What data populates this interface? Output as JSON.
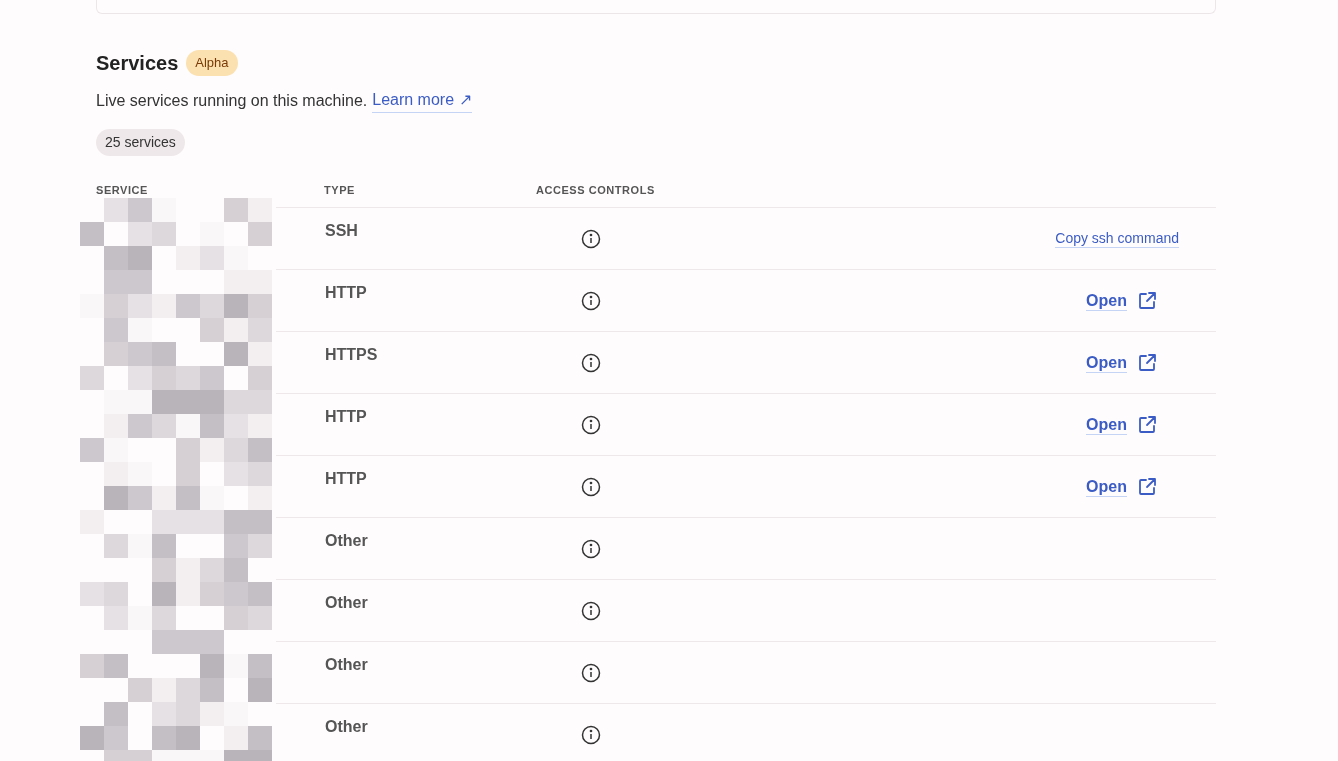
{
  "section": {
    "title": "Services",
    "badge": "Alpha",
    "description": "Live services running on this machine.",
    "learn_more": "Learn more ↗",
    "count": "25 services"
  },
  "table": {
    "columns": [
      "SERVICE",
      "TYPE",
      "ACCESS CONTROLS"
    ],
    "rows": [
      {
        "type": "SSH",
        "action": {
          "kind": "copy",
          "label": "Copy ssh command"
        }
      },
      {
        "type": "HTTP",
        "action": {
          "kind": "open",
          "label": "Open"
        }
      },
      {
        "type": "HTTPS",
        "action": {
          "kind": "open",
          "label": "Open"
        }
      },
      {
        "type": "HTTP",
        "action": {
          "kind": "open",
          "label": "Open"
        }
      },
      {
        "type": "HTTP",
        "action": {
          "kind": "open",
          "label": "Open"
        }
      },
      {
        "type": "Other"
      },
      {
        "type": "Other"
      },
      {
        "type": "Other"
      },
      {
        "type": "Other"
      }
    ]
  }
}
